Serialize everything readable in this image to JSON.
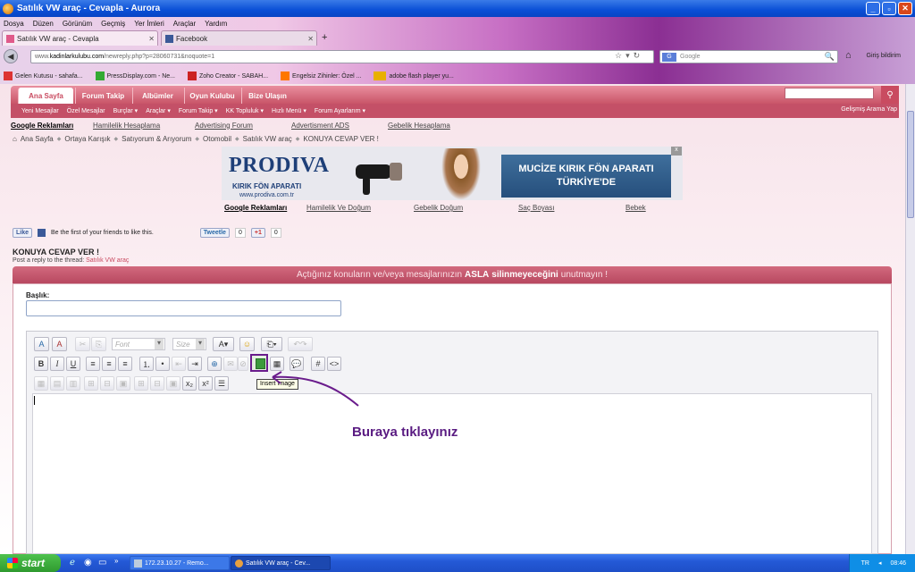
{
  "window": {
    "title": "Satılık VW araç - Cevapla - Aurora"
  },
  "menu": [
    "Dosya",
    "Düzen",
    "Görünüm",
    "Geçmiş",
    "Yer İmleri",
    "Araçlar",
    "Yardım"
  ],
  "tabs": [
    {
      "label": "Satılık VW araç - Cevapla",
      "active": true
    },
    {
      "label": "Facebook",
      "active": false
    }
  ],
  "address": {
    "url_prefix": "www.",
    "url_domain": "kadinlarkulubu.com",
    "url_rest": "/newreply.php?p=28060731&noquote=1"
  },
  "search": {
    "placeholder": "Google",
    "engine_badge": "G"
  },
  "bookmarks": [
    "Gelen Kutusu - sahafa...",
    "PressDisplay.com - Ne...",
    "Zoho Creator - SABAH...",
    "Engelsiz Zihinler: Özel ...",
    "adobe flash player yu..."
  ],
  "notify": "Giriş bildirim",
  "site_nav": {
    "tabs": [
      "Ana Sayfa",
      "Forum Takip",
      "Albümler",
      "Oyun Kulubu",
      "Bize Ulaşın"
    ],
    "sub": [
      "Yeni Mesajlar",
      "Özel Mesajlar",
      "Burçlar ▾",
      "Araçlar ▾",
      "Forum Takip ▾",
      "KK Topluluk ▾",
      "Hızlı Menü ▾",
      "Forum Ayarlarım ▾"
    ],
    "advanced_search": "Gelişmiş Arama Yap"
  },
  "ad_links_top": [
    "Google Reklamları",
    "Hamilelik Hesaplama",
    "Advertising Forum",
    "Advertisment ADS",
    "Gebelik Hesaplama"
  ],
  "breadcrumbs": [
    "Ana Sayfa",
    "Ortaya Karışık",
    "Satıyorum & Arıyorum",
    "Otomobil",
    "Satılık VW araç",
    "KONUYA CEVAP VER !"
  ],
  "banner": {
    "brand": "PRODIVA",
    "tagline": "KIRIK FÖN APARATI",
    "site": "www.prodiva.com.tr",
    "headline_1": "MUCİZE KIRIK FÖN APARATI",
    "headline_2": "TÜRKİYE'DE",
    "close": "x"
  },
  "ad_links_bottom": [
    "Google Reklamları",
    "Hamilelik Ve Doğum",
    "Gebelik Doğum",
    "Saç Boyası",
    "Bebek"
  ],
  "social": {
    "like": "Like",
    "like_text": "Be the first of your friends to like this.",
    "tweet": "Tweetle",
    "tweet_count": "0",
    "plus": "+1",
    "plus_count": "0"
  },
  "thread": {
    "heading": "KONUYA CEVAP VER !",
    "reply_prefix": "Post a reply to the thread:",
    "reply_thread": "Satılık VW araç"
  },
  "notice": {
    "before": "Açtığınız konuların ve/veya mesajlarınızın",
    "bold_1": "ASLA",
    "bold_2": "silinmeyeceğini",
    "after": "unutmayın !"
  },
  "form": {
    "title_label": "Başlık:",
    "title_value": ""
  },
  "editor": {
    "font_placeholder": "Font",
    "size_placeholder": "Size",
    "tooltip": "Insert Image",
    "b": "B",
    "i": "I",
    "u": "U",
    "hash": "#",
    "code": "<>",
    "sub": "x₂",
    "sup": "x²"
  },
  "annotation": "Buraya tıklayınız",
  "taskbar": {
    "start": "start",
    "tasks": [
      "172.23.10.27 - Remo...",
      "Satılık VW araç - Cev..."
    ],
    "lang": "TR",
    "time": "08:46"
  },
  "colors": {
    "accent": "#c94b60",
    "annotation": "#5a1c82",
    "banner_blue": "#1e3f78"
  }
}
